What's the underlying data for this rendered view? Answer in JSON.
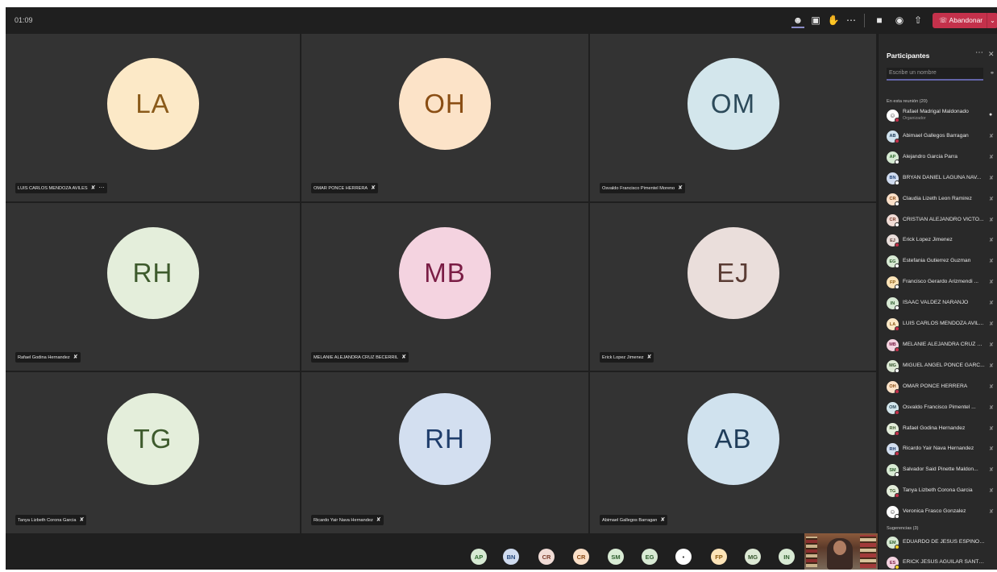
{
  "topbar": {
    "timer": "01:09",
    "leave_label": "Abandonar",
    "icons": [
      "participants-icon",
      "chat-icon",
      "raise-hand-icon",
      "more-options-icon",
      "camera-icon",
      "microphone-icon",
      "share-screen-icon"
    ],
    "leave_color": "#c4314b"
  },
  "tiles": [
    {
      "initials": "LA",
      "name": "LUIS CARLOS MENDOZA AVILES",
      "bg": "#fce9c7",
      "fg": "#8a5a1a",
      "has_more": true
    },
    {
      "initials": "OH",
      "name": "OMAR PONCE HERRERA",
      "bg": "#fce3c8",
      "fg": "#8a4e14"
    },
    {
      "initials": "OM",
      "name": "Osvaldo Francisco Pimentel Moreno",
      "bg": "#d3e6ec",
      "fg": "#2c4a5a"
    },
    {
      "initials": "RH",
      "name": "Rafael Godina Hernandez",
      "bg": "#e4eedb",
      "fg": "#3d5a2c"
    },
    {
      "initials": "MB",
      "name": "MELANIE ALEJANDRA CRUZ BECERRIL",
      "bg": "#f4d3e0",
      "fg": "#7a1d45"
    },
    {
      "initials": "EJ",
      "name": "Erick Lopez Jimenez",
      "bg": "#eadedb",
      "fg": "#5a3c34"
    },
    {
      "initials": "TG",
      "name": "Tanya Lizbeth Corona Garcia",
      "bg": "#e4eedb",
      "fg": "#3d5a2c"
    },
    {
      "initials": "RH",
      "name": "Ricardo Yair Nava Hernandez",
      "bg": "#d3dff0",
      "fg": "#1f3d6b"
    },
    {
      "initials": "AB",
      "name": "Abimael Gallegos Barragan",
      "bg": "#d0e2ee",
      "fg": "#1f3d5a"
    }
  ],
  "bottom_chips": [
    {
      "initials": "AP",
      "bg": "#d6ead3",
      "fg": "#2d6a2d"
    },
    {
      "initials": "BN",
      "bg": "#d0dcf0",
      "fg": "#24477a"
    },
    {
      "initials": "CR",
      "bg": "#f1dcd6",
      "fg": "#7a3b2a"
    },
    {
      "initials": "CR",
      "bg": "#fbe0c8",
      "fg": "#8a4a14"
    },
    {
      "initials": "SM",
      "bg": "#d9ecd5",
      "fg": "#2d5e2d"
    },
    {
      "initials": "EG",
      "bg": "#d8ead4",
      "fg": "#2e5e2e"
    },
    {
      "initials": "",
      "bg": "#ffffff",
      "fg": "#333333"
    },
    {
      "initials": "FP",
      "bg": "#fde4b8",
      "fg": "#8a5a10"
    },
    {
      "initials": "MG",
      "bg": "#dde9d5",
      "fg": "#35552d"
    },
    {
      "initials": "IN",
      "bg": "#d8ead4",
      "fg": "#2e5e2e"
    }
  ],
  "panel": {
    "title": "Participantes",
    "search_placeholder": "Escribe un nombre",
    "in_meeting_label": "En esta reunión (20)",
    "suggestions_label": "Sugerencias (3)",
    "participants": [
      {
        "initials": "",
        "name": "Rafael Madrigal Maldonado",
        "role": "Organizador",
        "bg": "#ffffff",
        "fg": "#333",
        "status": "#c4314b",
        "mic": "on"
      },
      {
        "initials": "AB",
        "name": "Abimael Gallegos Barragan",
        "bg": "#d0e2ee",
        "fg": "#1f3d5a",
        "status": "#c4314b",
        "mic": "off"
      },
      {
        "initials": "AP",
        "name": "Alejandro Garcia Parra",
        "bg": "#d6ead3",
        "fg": "#2d6a2d",
        "status": "#ffffff",
        "mic": "off"
      },
      {
        "initials": "BN",
        "name": "BRYAN DANIEL LAGUNA NAV...",
        "bg": "#d0dcf0",
        "fg": "#24477a",
        "status": "#ffffff",
        "mic": "off"
      },
      {
        "initials": "CR",
        "name": "Claudia Lizeth Leon Ramirez",
        "bg": "#fbe0c8",
        "fg": "#8a4a14",
        "status": "#ffffff",
        "mic": "off"
      },
      {
        "initials": "CR",
        "name": "CRISTIAN ALEJANDRO VICTO...",
        "bg": "#f1dcd6",
        "fg": "#7a3b2a",
        "status": "#ffffff",
        "mic": "off"
      },
      {
        "initials": "EJ",
        "name": "Erick Lopez Jimenez",
        "bg": "#eadedb",
        "fg": "#5a3c34",
        "status": "#c4314b",
        "mic": "off"
      },
      {
        "initials": "EG",
        "name": "Estefania Gutierrez Guzman",
        "bg": "#d8ead4",
        "fg": "#2e5e2e",
        "status": "#ffffff",
        "mic": "off"
      },
      {
        "initials": "FP",
        "name": "Francisco Gerardo Arizmendi ...",
        "bg": "#fde4b8",
        "fg": "#8a5a10",
        "status": "#ffffff",
        "mic": "off"
      },
      {
        "initials": "IN",
        "name": "ISAAC VALDEZ NARANJO",
        "bg": "#d8ead4",
        "fg": "#2e5e2e",
        "status": "#ffffff",
        "mic": "off"
      },
      {
        "initials": "LA",
        "name": "LUIS CARLOS MENDOZA AVIL...",
        "bg": "#fce9c7",
        "fg": "#8a5a1a",
        "status": "#c4314b",
        "mic": "off"
      },
      {
        "initials": "MB",
        "name": "MELANIE ALEJANDRA CRUZ B...",
        "bg": "#f4d3e0",
        "fg": "#7a1d45",
        "status": "#c4314b",
        "mic": "off"
      },
      {
        "initials": "MG",
        "name": "MIGUEL ANGEL PONCE GARC...",
        "bg": "#dde9d5",
        "fg": "#35552d",
        "status": "#ffffff",
        "mic": "off"
      },
      {
        "initials": "OH",
        "name": "OMAR PONCE HERRERA",
        "bg": "#fce3c8",
        "fg": "#8a4e14",
        "status": "#c4314b",
        "mic": "off"
      },
      {
        "initials": "OM",
        "name": "Osvaldo Francisco Pimentel ...",
        "bg": "#d3e6ec",
        "fg": "#2c4a5a",
        "status": "#c4314b",
        "mic": "off"
      },
      {
        "initials": "RH",
        "name": "Rafael Godina Hernandez",
        "bg": "#e4eedb",
        "fg": "#3d5a2c",
        "status": "#c4314b",
        "mic": "off"
      },
      {
        "initials": "RH",
        "name": "Ricardo Yair Nava Hernandez",
        "bg": "#d3dff0",
        "fg": "#1f3d6b",
        "status": "#c4314b",
        "mic": "off"
      },
      {
        "initials": "SM",
        "name": "Salvador Said Pinette Maldon...",
        "bg": "#d9ecd5",
        "fg": "#2d5e2d",
        "status": "#ffffff",
        "mic": "off"
      },
      {
        "initials": "TG",
        "name": "Tanya Lizbeth Corona Garcia",
        "bg": "#e4eedb",
        "fg": "#3d5a2c",
        "status": "#c4314b",
        "mic": "off"
      },
      {
        "initials": "",
        "name": "Veronica Frasco Gonzalez",
        "bg": "#ffffff",
        "fg": "#333",
        "status": "#ffffff",
        "mic": "off"
      }
    ],
    "suggestions": [
      {
        "initials": "EM",
        "name": "EDUARDO DE JESUS ESPINOSA D...",
        "bg": "#d8ead4",
        "fg": "#2e5e2e",
        "status": "#f8d22a"
      },
      {
        "initials": "ES",
        "name": "ERICK JESUS AGUILAR SANTIAGO",
        "bg": "#f4d3e0",
        "fg": "#7a1d45",
        "status": "#f8d22a"
      }
    ]
  }
}
